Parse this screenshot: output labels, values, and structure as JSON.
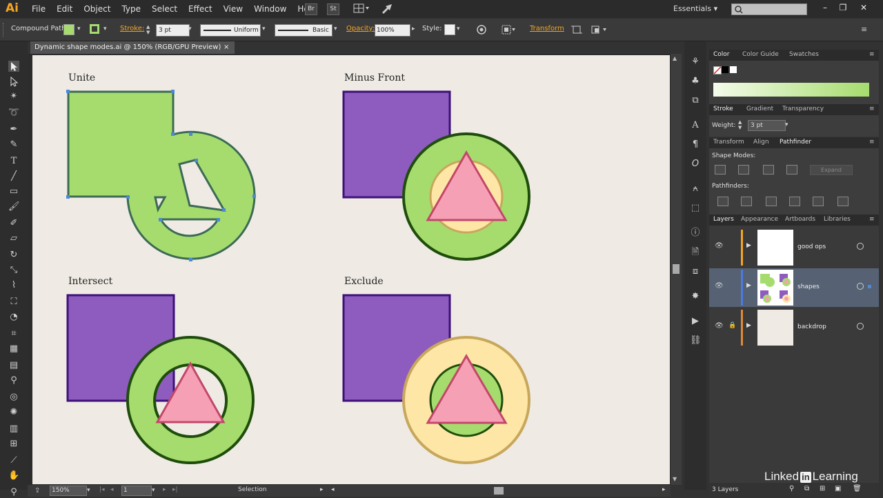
{
  "app": {
    "logo": "Ai"
  },
  "menu": [
    "File",
    "Edit",
    "Object",
    "Type",
    "Select",
    "Effect",
    "View",
    "Window",
    "Help"
  ],
  "menubar_buttons": {
    "br": "Br",
    "st": "St"
  },
  "workspace": "Essentials",
  "control": {
    "selection_type": "Compound Path",
    "stroke_label": "Stroke:",
    "stroke_weight": "3 pt",
    "profile": "Uniform",
    "brush": "Basic",
    "opacity_label": "Opacity:",
    "opacity": "100%",
    "style_label": "Style:",
    "transform_label": "Transform"
  },
  "document_tab": {
    "title": "Dynamic shape modes.ai @ 150% (RGB/GPU Preview)",
    "close": "×"
  },
  "artboard": {
    "labels": {
      "unite": "Unite",
      "minus_front": "Minus Front",
      "intersect": "Intersect",
      "exclude": "Exclude"
    },
    "colors": {
      "green": "#a6dc6e",
      "purple": "#8e5bbf",
      "pink": "#f6a0b6",
      "yellow": "#fee6a6",
      "dark_green": "#1f4d0c",
      "dark_purple": "#3d1078",
      "gold": "#c7a75c",
      "bg": "#efebe4"
    }
  },
  "status": {
    "zoom": "150%",
    "artboard_num": "1",
    "tool": "Selection"
  },
  "panels": {
    "color_tabs": [
      "Color",
      "Color Guide",
      "Swatches"
    ],
    "stroke_tabs": [
      "Stroke",
      "Gradient",
      "Transparency"
    ],
    "weight_label": "Weight:",
    "weight_value": "3 pt",
    "pathfinder_tabs": [
      "Transform",
      "Align",
      "Pathfinder"
    ],
    "shape_modes_label": "Shape Modes:",
    "expand_label": "Expand",
    "pathfinders_label": "Pathfinders:",
    "layers_tabs": [
      "Layers",
      "Appearance",
      "Artboards",
      "Libraries"
    ],
    "layers": [
      {
        "name": "good ops",
        "color": "#f5a623"
      },
      {
        "name": "shapes",
        "color": "#4a7be0"
      },
      {
        "name": "backdrop",
        "color": "#e08a3a"
      }
    ],
    "layer_count": "3 Layers"
  },
  "watermark": {
    "left": "Linked",
    "in": "in",
    "right": "Learning"
  }
}
